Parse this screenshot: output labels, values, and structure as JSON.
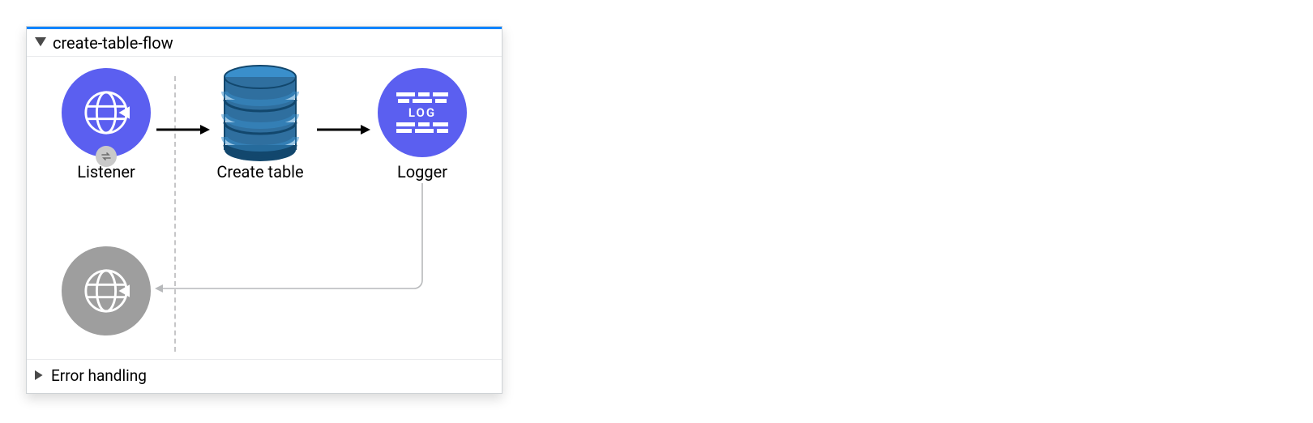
{
  "flow": {
    "title": "create-table-flow",
    "error_section": "Error handling",
    "nodes": {
      "listener": {
        "label": "Listener"
      },
      "create_table": {
        "label": "Create table"
      },
      "logger": {
        "label": "Logger",
        "log_text": "LOG"
      }
    }
  },
  "colors": {
    "accent": "#0b84ff",
    "node_primary": "#5b5ff0",
    "node_response": "#9e9e9e",
    "db_dark": "#12476d",
    "db_mid": "#2f6f9f",
    "db_light": "#3a8fcb"
  }
}
